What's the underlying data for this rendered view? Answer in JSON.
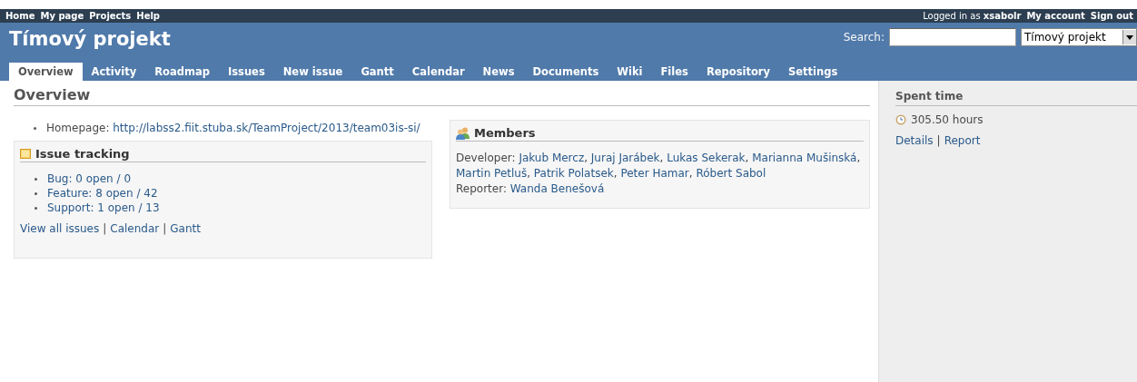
{
  "top_menu": {
    "left": [
      "Home",
      "My page",
      "Projects",
      "Help"
    ],
    "logged_in_label": "Logged in as",
    "user": "xsabolr",
    "right": [
      "My account",
      "Sign out"
    ]
  },
  "header": {
    "title": "Tímový projekt",
    "search_label": "Search:",
    "project_select": "Tímový projekt"
  },
  "tabs": [
    {
      "label": "Overview",
      "selected": true
    },
    {
      "label": "Activity",
      "selected": false
    },
    {
      "label": "Roadmap",
      "selected": false
    },
    {
      "label": "Issues",
      "selected": false
    },
    {
      "label": "New issue",
      "selected": false
    },
    {
      "label": "Gantt",
      "selected": false
    },
    {
      "label": "Calendar",
      "selected": false
    },
    {
      "label": "News",
      "selected": false
    },
    {
      "label": "Documents",
      "selected": false
    },
    {
      "label": "Wiki",
      "selected": false
    },
    {
      "label": "Files",
      "selected": false
    },
    {
      "label": "Repository",
      "selected": false
    },
    {
      "label": "Settings",
      "selected": false
    }
  ],
  "page_title": "Overview",
  "homepage": {
    "label": "Homepage:",
    "url": "http://labss2.fiit.stuba.sk/TeamProject/2013/team03is-si/"
  },
  "issue_tracking": {
    "title": "Issue tracking",
    "trackers": [
      "Bug: 0 open / 0",
      "Feature: 8 open / 42",
      "Support: 1 open / 13"
    ],
    "links": [
      "View all issues",
      "Calendar",
      "Gantt"
    ],
    "separator": "|"
  },
  "members": {
    "title": "Members",
    "separator": ",",
    "roles": [
      {
        "role": "Developer:",
        "names": [
          "Jakub Mercz",
          "Juraj Jarábek",
          "Lukas Sekerak",
          "Marianna Mušinská",
          "Martin Petluš",
          "Patrik Polatsek",
          "Peter Hamar",
          "Róbert Sabol"
        ]
      },
      {
        "role": "Reporter:",
        "names": [
          "Wanda Benešová"
        ]
      }
    ]
  },
  "sidebar": {
    "title": "Spent time",
    "hours": "305.50 hours",
    "links": [
      "Details",
      "Report"
    ],
    "separator": "|"
  }
}
